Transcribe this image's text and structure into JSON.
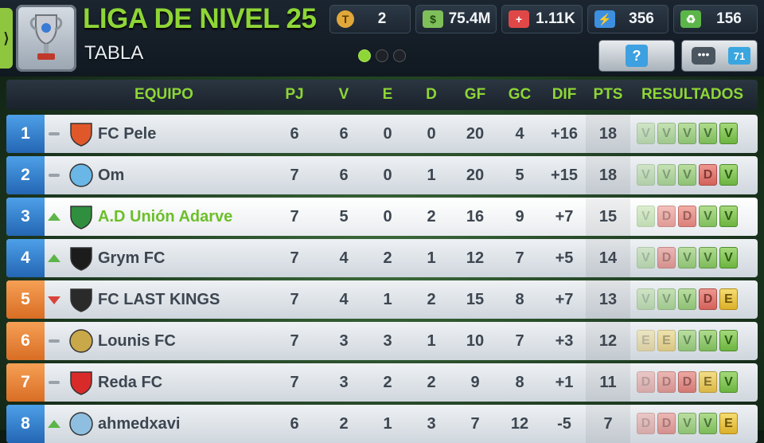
{
  "header": {
    "league_title": "LIGA DE NIVEL 25",
    "subtitle": "TABLA",
    "stats": [
      {
        "name": "tokens",
        "icon": "token-coin-icon",
        "glyph": "T",
        "value": "2",
        "color": "#e0a83a"
      },
      {
        "name": "money",
        "icon": "cash-icon",
        "glyph": "$",
        "value": "75.4M",
        "color": "#7fbf5a"
      },
      {
        "name": "medical",
        "icon": "medical-cross-icon",
        "glyph": "+",
        "value": "1.11K",
        "color": "#e04848"
      },
      {
        "name": "energy",
        "icon": "energy-bolt-icon",
        "glyph": "⚡",
        "value": "356",
        "color": "#3d8fe0"
      },
      {
        "name": "morale",
        "icon": "morale-cash-icon",
        "glyph": "♻",
        "value": "156",
        "color": "#5cb548"
      }
    ],
    "help_label": "?",
    "chat_badge": "71"
  },
  "table": {
    "columns": {
      "team": "EQUIPO",
      "pj": "PJ",
      "v": "V",
      "e": "E",
      "d": "D",
      "gf": "GF",
      "gc": "GC",
      "dif": "DIF",
      "pts": "PTS",
      "results": "RESULTADOS"
    },
    "rows": [
      {
        "pos": "1",
        "trend": "same",
        "team": "FC Pele",
        "pj": "6",
        "v": "6",
        "e": "0",
        "d": "0",
        "gf": "20",
        "gc": "4",
        "dif": "+16",
        "pts": "18",
        "results": [
          "V",
          "V",
          "V",
          "V",
          "V"
        ],
        "zone": "blue",
        "crest_color": "#e0582a",
        "crest_shape": "shield"
      },
      {
        "pos": "2",
        "trend": "same",
        "team": "Om",
        "pj": "7",
        "v": "6",
        "e": "0",
        "d": "1",
        "gf": "20",
        "gc": "5",
        "dif": "+15",
        "pts": "18",
        "results": [
          "V",
          "V",
          "V",
          "D",
          "V"
        ],
        "zone": "blue",
        "crest_color": "#6ab6e6",
        "crest_shape": "circle"
      },
      {
        "pos": "3",
        "trend": "up",
        "team": "A.D Unión Adarve",
        "pj": "7",
        "v": "5",
        "e": "0",
        "d": "2",
        "gf": "16",
        "gc": "9",
        "dif": "+7",
        "pts": "15",
        "results": [
          "V",
          "D",
          "D",
          "V",
          "V"
        ],
        "zone": "blue",
        "crest_color": "#2f8f3e",
        "crest_shape": "shield",
        "mine": true
      },
      {
        "pos": "4",
        "trend": "up",
        "team": "Grym FC",
        "pj": "7",
        "v": "4",
        "e": "2",
        "d": "1",
        "gf": "12",
        "gc": "7",
        "dif": "+5",
        "pts": "14",
        "results": [
          "V",
          "D",
          "V",
          "V",
          "V"
        ],
        "zone": "blue",
        "crest_color": "#1c1c1c",
        "crest_shape": "shield"
      },
      {
        "pos": "5",
        "trend": "down",
        "team": "FC LAST KINGS",
        "pj": "7",
        "v": "4",
        "e": "1",
        "d": "2",
        "gf": "15",
        "gc": "8",
        "dif": "+7",
        "pts": "13",
        "results": [
          "V",
          "V",
          "V",
          "D",
          "E"
        ],
        "zone": "orange",
        "crest_color": "#2a2a2a",
        "crest_shape": "shield"
      },
      {
        "pos": "6",
        "trend": "same",
        "team": "Lounis FC",
        "pj": "7",
        "v": "3",
        "e": "3",
        "d": "1",
        "gf": "10",
        "gc": "7",
        "dif": "+3",
        "pts": "12",
        "results": [
          "E",
          "E",
          "V",
          "V",
          "V"
        ],
        "zone": "orange",
        "crest_color": "#c9a84a",
        "crest_shape": "circle"
      },
      {
        "pos": "7",
        "trend": "same",
        "team": "Reda FC",
        "pj": "7",
        "v": "3",
        "e": "2",
        "d": "2",
        "gf": "9",
        "gc": "8",
        "dif": "+1",
        "pts": "11",
        "results": [
          "D",
          "D",
          "D",
          "E",
          "V"
        ],
        "zone": "orange",
        "crest_color": "#d92a2a",
        "crest_shape": "shield"
      },
      {
        "pos": "8",
        "trend": "up",
        "team": "ahmedxavi",
        "pj": "6",
        "v": "2",
        "e": "1",
        "d": "3",
        "gf": "7",
        "gc": "12",
        "dif": "-5",
        "pts": "7",
        "results": [
          "D",
          "D",
          "V",
          "V",
          "E"
        ],
        "zone": "blue",
        "crest_color": "#8fbfe0",
        "crest_shape": "circle"
      }
    ]
  }
}
